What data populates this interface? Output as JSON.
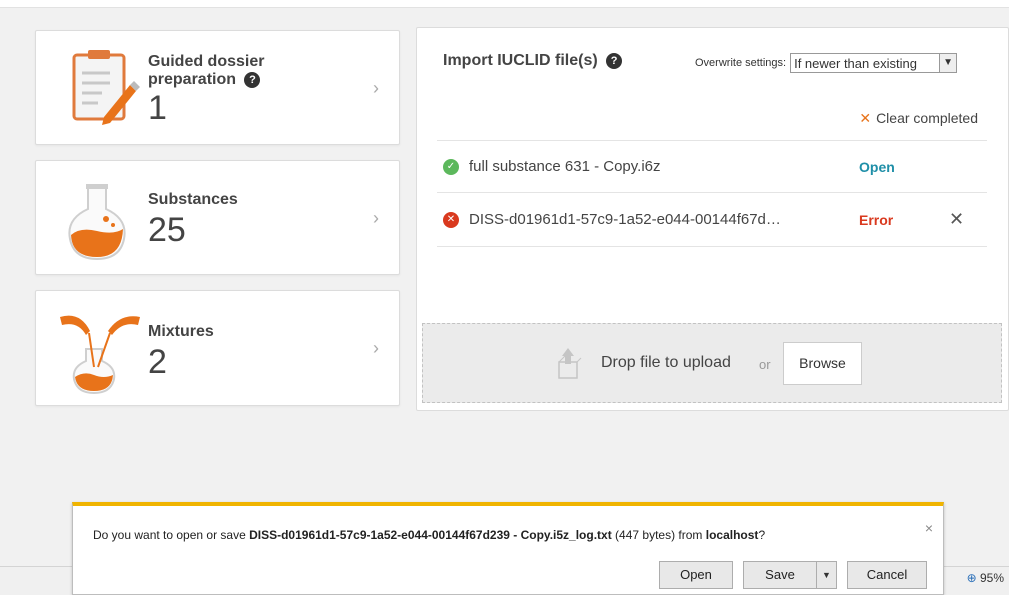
{
  "cards": [
    {
      "title_line1": "Guided dossier",
      "title_line2": "preparation",
      "help": "?",
      "count": "1",
      "chevron": "›"
    },
    {
      "title": "Substances",
      "count": "25",
      "chevron": "›"
    },
    {
      "title": "Mixtures",
      "count": "2",
      "chevron": "›"
    }
  ],
  "import": {
    "title": "Import IUCLID file(s)",
    "help": "?",
    "overwrite_label": "Overwrite settings:",
    "overwrite_value": "If newer than existing",
    "clear_icon": "✕",
    "clear_label": "Clear completed",
    "files": [
      {
        "name": "full substance 631 - Copy.i6z",
        "action": "Open",
        "status_glyph": "✓",
        "remove": ""
      },
      {
        "name": "DISS-d01961d1-57c9-1a52-e044-00144f67d…",
        "action": "Error",
        "status_glyph": "✕",
        "remove": "✕"
      }
    ],
    "drop_text": "Drop file to upload",
    "or_text": "or",
    "browse_label": "Browse"
  },
  "notification": {
    "prefix": "Do you want to open or save ",
    "filename": "DISS-d01961d1-57c9-1a52-e044-00144f67d239 - Copy.i5z_log.txt",
    "size": " (447 bytes) from ",
    "host": "localhost",
    "suffix": "?",
    "close": "×",
    "open_label": "Open",
    "save_label": "Save",
    "save_arrow": "▼",
    "cancel_label": "Cancel"
  },
  "zoom_label": "95%",
  "colors": {
    "accent_orange": "#e8731a",
    "open_teal": "#1f8fa8",
    "error_red": "#d9391e",
    "ok_green": "#5cb85c",
    "notify_bar": "#f0b400"
  }
}
